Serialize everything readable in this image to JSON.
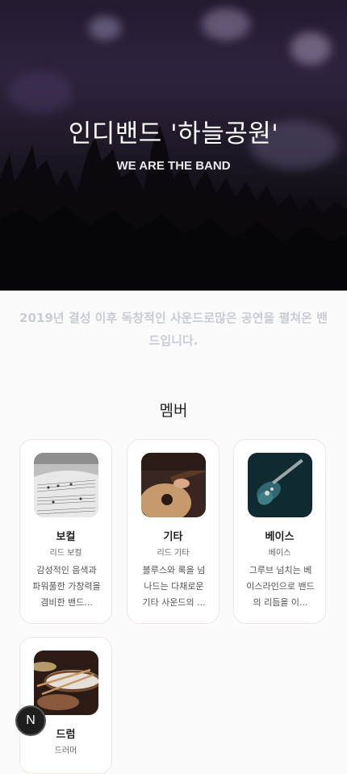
{
  "hero": {
    "title": "인디밴드 '하늘공원'",
    "subtitle": "WE ARE THE BAND"
  },
  "intro": "2019년 결성 이후 독창적인 사운드로많은 공연을 펼쳐온 밴드입니다.",
  "members_section": {
    "title": "멤버",
    "members": [
      {
        "name": "보컬",
        "role": "리드 보컬",
        "desc": "감성적인 음색과 파워풀한 가창력을 겸비한 밴드...",
        "photo_icon": "sheet-music-icon"
      },
      {
        "name": "기타",
        "role": "리드 기타",
        "desc": "블루스와 록을 넘나드는 다채로운 기타 사운드의 ...",
        "photo_icon": "guitar-icon"
      },
      {
        "name": "베이스",
        "role": "베이스",
        "desc": "그루브 넘치는 베이스라인으로 밴드의 리듬을 이...",
        "photo_icon": "bass-guitar-icon"
      },
      {
        "name": "드럼",
        "role": "드러머",
        "desc": "",
        "photo_icon": "drum-kit-icon"
      }
    ]
  },
  "fab": {
    "label": "N"
  }
}
